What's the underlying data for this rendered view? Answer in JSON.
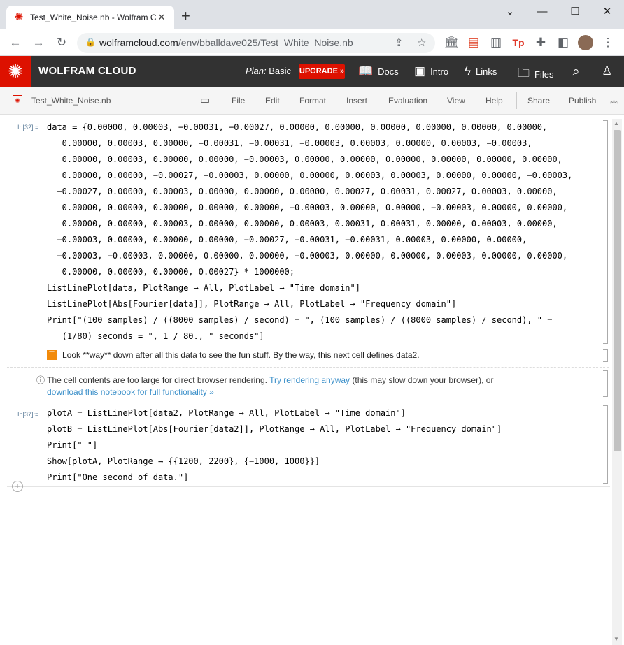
{
  "browser": {
    "tab_title": "Test_White_Noise.nb - Wolfram C",
    "url_host": "wolframcloud.com",
    "url_path": "/env/bballdave025/Test_White_Noise.nb"
  },
  "header": {
    "title": "WOLFRAM CLOUD",
    "plan_label": "Plan:",
    "plan_value": "Basic",
    "upgrade": "UPGRADE »",
    "docs": "Docs",
    "intro": "Intro",
    "links": "Links",
    "files": "Files"
  },
  "toolbar": {
    "notebook_name": "Test_White_Noise.nb",
    "menus": [
      "File",
      "Edit",
      "Format",
      "Insert",
      "Evaluation",
      "View",
      "Help"
    ],
    "share": "Share",
    "publish": "Publish"
  },
  "cell32": {
    "label": "In[32]:=",
    "data_lines": [
      "data = {0.00000, 0.00003, −0.00031, −0.00027, 0.00000, 0.00000, 0.00000, 0.00000, 0.00000, 0.00000,",
      "   0.00000, 0.00003, 0.00000, −0.00031, −0.00031, −0.00003, 0.00003, 0.00000, 0.00003, −0.00003,",
      "   0.00000, 0.00003, 0.00000, 0.00000, −0.00003, 0.00000, 0.00000, 0.00000, 0.00000, 0.00000, 0.00000,",
      "   0.00000, 0.00000, −0.00027, −0.00003, 0.00000, 0.00000, 0.00003, 0.00003, 0.00000, 0.00000, −0.00003,",
      "  −0.00027, 0.00000, 0.00003, 0.00000, 0.00000, 0.00000, 0.00027, 0.00031, 0.00027, 0.00003, 0.00000,",
      "   0.00000, 0.00000, 0.00000, 0.00000, 0.00000, −0.00003, 0.00000, 0.00000, −0.00003, 0.00000, 0.00000,",
      "   0.00000, 0.00000, 0.00003, 0.00000, 0.00000, 0.00003, 0.00031, 0.00031, 0.00000, 0.00003, 0.00000,",
      "  −0.00003, 0.00000, 0.00000, 0.00000, −0.00027, −0.00031, −0.00031, 0.00003, 0.00000, 0.00000,",
      "  −0.00003, −0.00003, 0.00000, 0.00000, 0.00000, −0.00003, 0.00000, 0.00000, 0.00003, 0.00000, 0.00000,",
      "   0.00000, 0.00000, 0.00000, 0.00027} * 1000000;"
    ],
    "plot1": "ListLinePlot[data, PlotRange → All, PlotLabel → \"Time domain\"]",
    "plot2": "ListLinePlot[Abs[Fourier[data]], PlotRange → All, PlotLabel → \"Frequency domain\"]",
    "print1": "Print[\"(100 samples) / ((8000 samples) / second) = \", (100 samples) / ((8000 samples) / second), \" =",
    "print2": "   (1/80) seconds = \", 1 / 80., \" seconds\"]"
  },
  "text_cell": "Look **way** down after all this data to see the fun stuff. By the way, this next cell defines data2.",
  "message": {
    "info": "The cell contents are too large for direct browser rendering.",
    "try_link": "Try rendering anyway",
    "rest": "(this may slow down your browser), or",
    "download_link": "download this notebook for full functionality »"
  },
  "cell37": {
    "label": "In[37]:=",
    "lines": [
      "plotA = ListLinePlot[data2, PlotRange → All, PlotLabel → \"Time domain\"]",
      "plotB = ListLinePlot[Abs[Fourier[data2]], PlotRange → All, PlotLabel → \"Frequency domain\"]",
      "Print[\" \"]",
      "Show[plotA, PlotRange → {{1200, 2200}, {−1000, 1000}}]",
      "Print[\"One second of data.\"]"
    ]
  }
}
